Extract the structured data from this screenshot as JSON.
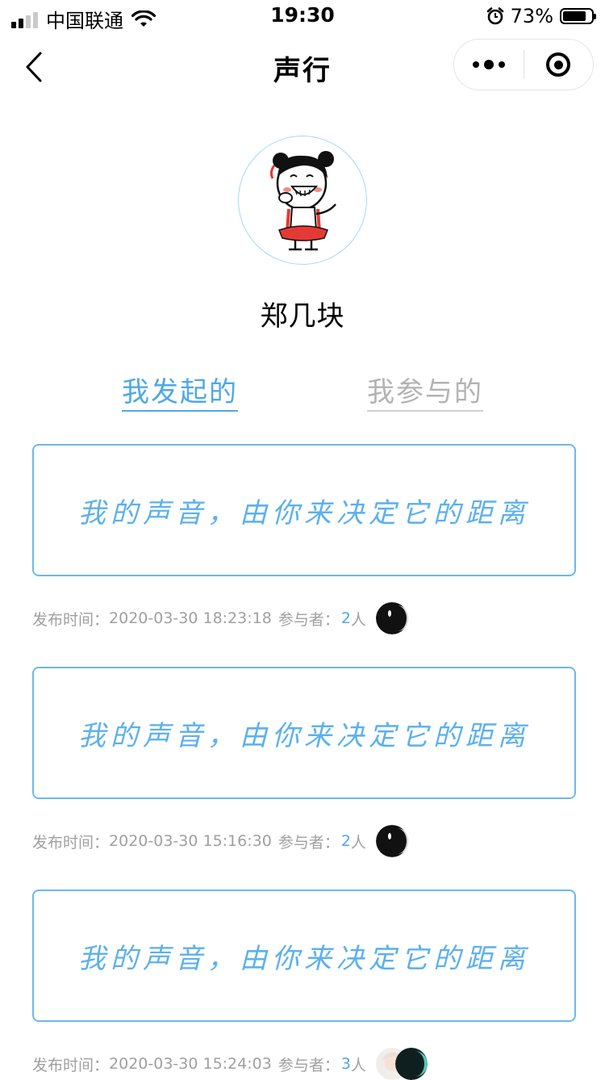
{
  "status_bar": {
    "carrier": "中国联通",
    "time": "19:30",
    "battery_percent": "73%",
    "battery_level": 0.73,
    "icons": [
      "signal-icon",
      "wifi-icon",
      "alarm-icon",
      "battery-icon"
    ]
  },
  "nav": {
    "title": "声行",
    "icons": [
      "back-chevron-icon",
      "more-dots-icon",
      "close-target-icon"
    ]
  },
  "profile": {
    "name": "郑几块"
  },
  "tabs": [
    {
      "label": "我发起的",
      "active": true
    },
    {
      "label": "我参与的",
      "active": false
    }
  ],
  "posts": [
    {
      "text": "我的声音，由你来决定它的距离",
      "publish_label": "发布时间：",
      "publish_time": "2020-03-30 18:23:18",
      "participants_label": "参与者：",
      "participants_count": "2",
      "participants_unit": "人"
    },
    {
      "text": "我的声音，由你来决定它的距离",
      "publish_label": "发布时间：",
      "publish_time": "2020-03-30 15:16:30",
      "participants_label": "参与者：",
      "participants_count": "2",
      "participants_unit": "人"
    },
    {
      "text": "我的声音，由你来决定它的距离",
      "publish_label": "发布时间：",
      "publish_time": "2020-03-30 15:24:03",
      "participants_label": "参与者：",
      "participants_count": "3",
      "participants_unit": "人"
    }
  ],
  "colors": {
    "accent": "#4ea8e8",
    "card_border": "#6cb8ee",
    "meta_text": "#a0a0a0",
    "inactive_tab": "#b3b3b3"
  }
}
